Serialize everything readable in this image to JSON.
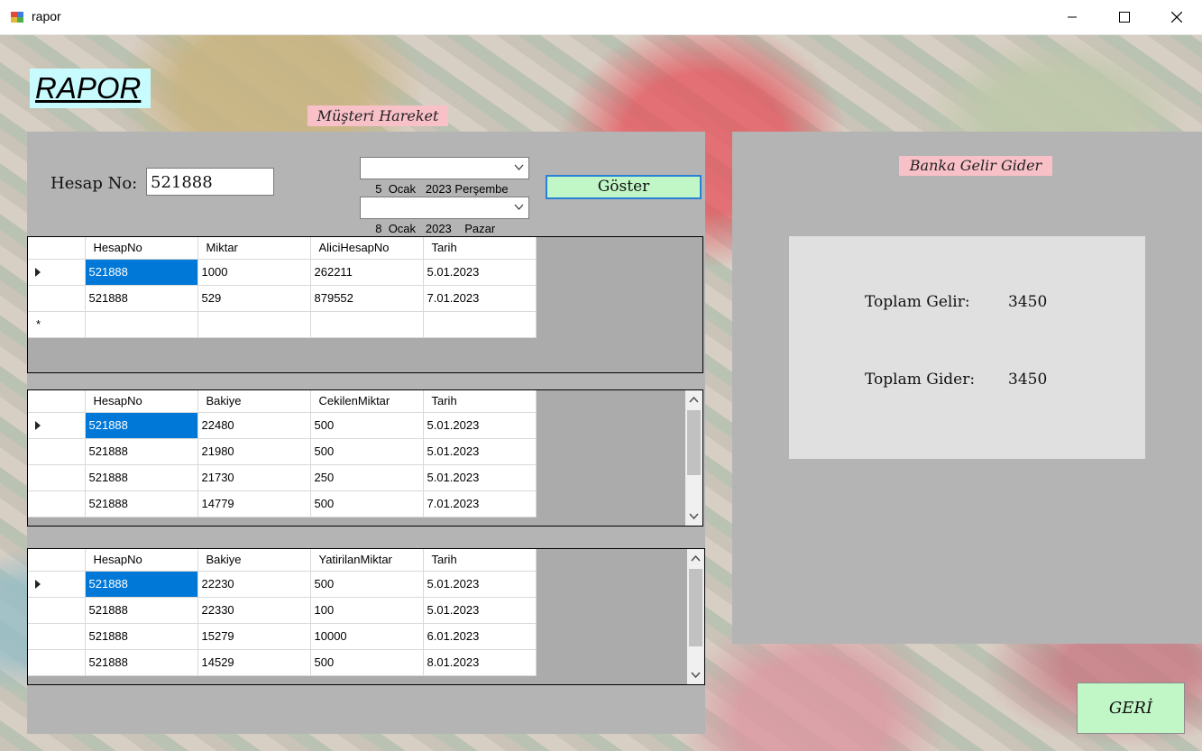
{
  "window": {
    "title": "rapor"
  },
  "labels": {
    "rapor": "RAPOR",
    "musteri_hareket": "Müşteri Hareket",
    "banka_gelir_gider": "Banka Gelir Gider"
  },
  "form": {
    "hesap_no_label": "Hesap No:",
    "hesap_no_value": "521888",
    "date_start": "5  Ocak   2023 Perşembe",
    "date_end": "8  Ocak   2023    Pazar",
    "goster_label": "Göster"
  },
  "grid_transfers": {
    "columns": [
      "HesapNo",
      "Miktar",
      "AliciHesapNo",
      "Tarih"
    ],
    "rows": [
      [
        "521888",
        "1000",
        "262211",
        "5.01.2023"
      ],
      [
        "521888",
        "529",
        "879552",
        "7.01.2023"
      ]
    ],
    "new_row_marker": "*"
  },
  "grid_withdrawals": {
    "columns": [
      "HesapNo",
      "Bakiye",
      "CekilenMiktar",
      "Tarih"
    ],
    "rows": [
      [
        "521888",
        "22480",
        "500",
        "5.01.2023"
      ],
      [
        "521888",
        "21980",
        "500",
        "5.01.2023"
      ],
      [
        "521888",
        "21730",
        "250",
        "5.01.2023"
      ],
      [
        "521888",
        "14779",
        "500",
        "7.01.2023"
      ]
    ]
  },
  "grid_deposits": {
    "columns": [
      "HesapNo",
      "Bakiye",
      "YatirilanMiktar",
      "Tarih"
    ],
    "rows": [
      [
        "521888",
        "22230",
        "500",
        "5.01.2023"
      ],
      [
        "521888",
        "22330",
        "100",
        "5.01.2023"
      ],
      [
        "521888",
        "15279",
        "10000",
        "6.01.2023"
      ],
      [
        "521888",
        "14529",
        "500",
        "8.01.2023"
      ]
    ]
  },
  "summary": {
    "gelir_label": "Toplam Gelir:",
    "gelir_value": "3450",
    "gider_label": "Toplam Gider:",
    "gider_value": "3450"
  },
  "buttons": {
    "geri": "GERİ"
  },
  "colors": {
    "accent_green": "#c1f7c6",
    "label_pink": "#f8c1c8",
    "label_cyan": "#c7fbfd",
    "selection": "#0078d7"
  }
}
